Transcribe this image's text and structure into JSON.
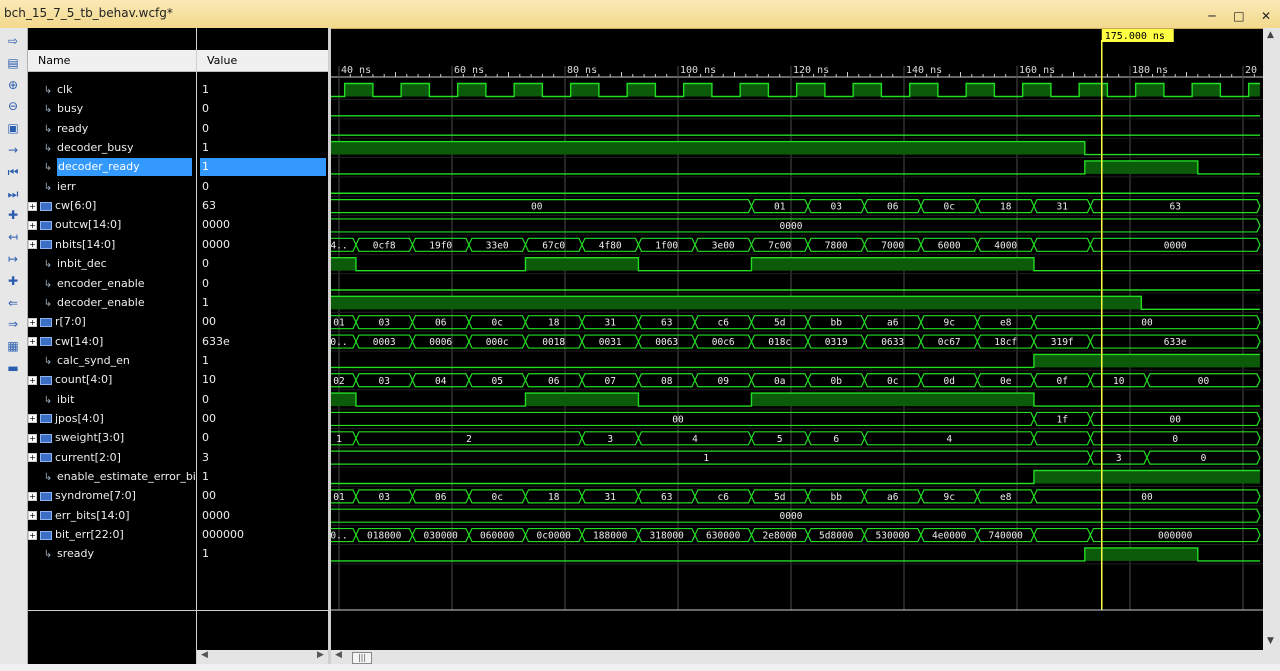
{
  "window": {
    "title": "bch_15_7_5_tb_behav.wcfg*"
  },
  "headers": {
    "name": "Name",
    "value": "Value"
  },
  "cursor": {
    "label": "175.000 ns",
    "time": 175
  },
  "timeline": {
    "ticks": [
      "40 ns",
      "60 ns",
      "80 ns",
      "100 ns",
      "120 ns",
      "140 ns",
      "160 ns",
      "180 ns",
      "20"
    ]
  },
  "signals": [
    {
      "name": "clk",
      "value": "1",
      "bus": false
    },
    {
      "name": "busy",
      "value": "0",
      "bus": false
    },
    {
      "name": "ready",
      "value": "0",
      "bus": false
    },
    {
      "name": "decoder_busy",
      "value": "1",
      "bus": false
    },
    {
      "name": "decoder_ready",
      "value": "1",
      "bus": false,
      "selected": true
    },
    {
      "name": "ierr",
      "value": "0",
      "bus": false
    },
    {
      "name": "cw[6:0]",
      "value": "63",
      "bus": true
    },
    {
      "name": "outcw[14:0]",
      "value": "0000",
      "bus": true
    },
    {
      "name": "nbits[14:0]",
      "value": "0000",
      "bus": true
    },
    {
      "name": "inbit_dec",
      "value": "0",
      "bus": false
    },
    {
      "name": "encoder_enable",
      "value": "0",
      "bus": false
    },
    {
      "name": "decoder_enable",
      "value": "1",
      "bus": false
    },
    {
      "name": "r[7:0]",
      "value": "00",
      "bus": true
    },
    {
      "name": "cw[14:0]",
      "value": "633e",
      "bus": true
    },
    {
      "name": "calc_synd_en",
      "value": "1",
      "bus": false
    },
    {
      "name": "count[4:0]",
      "value": "10",
      "bus": true
    },
    {
      "name": "ibit",
      "value": "0",
      "bus": false
    },
    {
      "name": "jpos[4:0]",
      "value": "00",
      "bus": true
    },
    {
      "name": "sweight[3:0]",
      "value": "0",
      "bus": true
    },
    {
      "name": "current[2:0]",
      "value": "3",
      "bus": true
    },
    {
      "name": "enable_estimate_error_bits",
      "value": "1",
      "bus": false
    },
    {
      "name": "syndrome[7:0]",
      "value": "00",
      "bus": true
    },
    {
      "name": "err_bits[14:0]",
      "value": "0000",
      "bus": true
    },
    {
      "name": "bit_err[22:0]",
      "value": "000000",
      "bus": true
    },
    {
      "name": "sready",
      "value": "1",
      "bus": false
    }
  ],
  "waves": [
    {
      "type": "clk"
    },
    {
      "type": "bit",
      "init": 0,
      "edges": []
    },
    {
      "type": "bit",
      "init": 0,
      "edges": []
    },
    {
      "type": "bit",
      "init": 1,
      "edges": [
        172
      ]
    },
    {
      "type": "bit",
      "init": 0,
      "edges": [
        172,
        192
      ]
    },
    {
      "type": "bit",
      "init": 0,
      "edges": []
    },
    {
      "type": "bus",
      "segs": [
        [
          37,
          113,
          "00"
        ],
        [
          113,
          123,
          "01"
        ],
        [
          123,
          133,
          "03"
        ],
        [
          133,
          143,
          "06"
        ],
        [
          143,
          153,
          "0c"
        ],
        [
          153,
          163,
          "18"
        ],
        [
          163,
          173,
          "31"
        ],
        [
          173,
          203,
          "63"
        ]
      ]
    },
    {
      "type": "bus",
      "segs": [
        [
          37,
          203,
          "0000"
        ]
      ]
    },
    {
      "type": "bus",
      "segs": [
        [
          37,
          43,
          "4.."
        ],
        [
          43,
          53,
          "0cf8"
        ],
        [
          53,
          63,
          "19f0"
        ],
        [
          63,
          73,
          "33e0"
        ],
        [
          73,
          83,
          "67c0"
        ],
        [
          83,
          93,
          "4f80"
        ],
        [
          93,
          103,
          "1f00"
        ],
        [
          103,
          113,
          "3e00"
        ],
        [
          113,
          123,
          "7c00"
        ],
        [
          123,
          133,
          "7800"
        ],
        [
          133,
          143,
          "7000"
        ],
        [
          143,
          153,
          "6000"
        ],
        [
          153,
          163,
          "4000"
        ],
        [
          163,
          173,
          ""
        ],
        [
          173,
          203,
          "0000"
        ]
      ]
    },
    {
      "type": "bit",
      "init": 1,
      "edges": [
        43,
        73,
        93,
        113,
        163
      ]
    },
    {
      "type": "bit",
      "init": 0,
      "edges": []
    },
    {
      "type": "bit",
      "init": 1,
      "edges": [
        182
      ]
    },
    {
      "type": "bus",
      "segs": [
        [
          37,
          43,
          "01"
        ],
        [
          43,
          53,
          "03"
        ],
        [
          53,
          63,
          "06"
        ],
        [
          63,
          73,
          "0c"
        ],
        [
          73,
          83,
          "18"
        ],
        [
          83,
          93,
          "31"
        ],
        [
          93,
          103,
          "63"
        ],
        [
          103,
          113,
          "c6"
        ],
        [
          113,
          123,
          "5d"
        ],
        [
          123,
          133,
          "bb"
        ],
        [
          133,
          143,
          "a6"
        ],
        [
          143,
          153,
          "9c"
        ],
        [
          153,
          163,
          "e8"
        ],
        [
          163,
          203,
          "00"
        ]
      ]
    },
    {
      "type": "bus",
      "segs": [
        [
          37,
          43,
          "0.."
        ],
        [
          43,
          53,
          "0003"
        ],
        [
          53,
          63,
          "0006"
        ],
        [
          63,
          73,
          "000c"
        ],
        [
          73,
          83,
          "0018"
        ],
        [
          83,
          93,
          "0031"
        ],
        [
          93,
          103,
          "0063"
        ],
        [
          103,
          113,
          "00c6"
        ],
        [
          113,
          123,
          "018c"
        ],
        [
          123,
          133,
          "0319"
        ],
        [
          133,
          143,
          "0633"
        ],
        [
          143,
          153,
          "0c67"
        ],
        [
          153,
          163,
          "18cf"
        ],
        [
          163,
          173,
          "319f"
        ],
        [
          173,
          203,
          "633e"
        ]
      ]
    },
    {
      "type": "bit",
      "init": 0,
      "edges": [
        163
      ]
    },
    {
      "type": "bus",
      "segs": [
        [
          37,
          43,
          "02"
        ],
        [
          43,
          53,
          "03"
        ],
        [
          53,
          63,
          "04"
        ],
        [
          63,
          73,
          "05"
        ],
        [
          73,
          83,
          "06"
        ],
        [
          83,
          93,
          "07"
        ],
        [
          93,
          103,
          "08"
        ],
        [
          103,
          113,
          "09"
        ],
        [
          113,
          123,
          "0a"
        ],
        [
          123,
          133,
          "0b"
        ],
        [
          133,
          143,
          "0c"
        ],
        [
          143,
          153,
          "0d"
        ],
        [
          153,
          163,
          "0e"
        ],
        [
          163,
          173,
          "0f"
        ],
        [
          173,
          183,
          "10"
        ],
        [
          183,
          203,
          "00"
        ]
      ]
    },
    {
      "type": "bit",
      "init": 1,
      "edges": [
        43,
        73,
        93,
        113,
        163
      ]
    },
    {
      "type": "bus",
      "segs": [
        [
          37,
          163,
          "00"
        ],
        [
          163,
          173,
          "1f"
        ],
        [
          173,
          203,
          "00"
        ]
      ]
    },
    {
      "type": "bus",
      "segs": [
        [
          37,
          43,
          "1"
        ],
        [
          43,
          83,
          "2"
        ],
        [
          83,
          93,
          "3"
        ],
        [
          93,
          113,
          "4"
        ],
        [
          113,
          123,
          "5"
        ],
        [
          123,
          133,
          "6"
        ],
        [
          133,
          163,
          "4"
        ],
        [
          163,
          173,
          ""
        ],
        [
          173,
          203,
          "0"
        ]
      ]
    },
    {
      "type": "bus",
      "segs": [
        [
          37,
          173,
          "1"
        ],
        [
          173,
          183,
          "3"
        ],
        [
          183,
          203,
          "0"
        ]
      ]
    },
    {
      "type": "bit",
      "init": 0,
      "edges": [
        163
      ]
    },
    {
      "type": "bus",
      "segs": [
        [
          37,
          43,
          "01"
        ],
        [
          43,
          53,
          "03"
        ],
        [
          53,
          63,
          "06"
        ],
        [
          63,
          73,
          "0c"
        ],
        [
          73,
          83,
          "18"
        ],
        [
          83,
          93,
          "31"
        ],
        [
          93,
          103,
          "63"
        ],
        [
          103,
          113,
          "c6"
        ],
        [
          113,
          123,
          "5d"
        ],
        [
          123,
          133,
          "bb"
        ],
        [
          133,
          143,
          "a6"
        ],
        [
          143,
          153,
          "9c"
        ],
        [
          153,
          163,
          "e8"
        ],
        [
          163,
          203,
          "00"
        ]
      ]
    },
    {
      "type": "bus",
      "segs": [
        [
          37,
          203,
          "0000"
        ]
      ]
    },
    {
      "type": "bus",
      "segs": [
        [
          37,
          43,
          "0.."
        ],
        [
          43,
          53,
          "018000"
        ],
        [
          53,
          63,
          "030000"
        ],
        [
          63,
          73,
          "060000"
        ],
        [
          73,
          83,
          "0c0000"
        ],
        [
          83,
          93,
          "188000"
        ],
        [
          93,
          103,
          "318000"
        ],
        [
          103,
          113,
          "630000"
        ],
        [
          113,
          123,
          "2e8000"
        ],
        [
          123,
          133,
          "5d8000"
        ],
        [
          133,
          143,
          "530000"
        ],
        [
          143,
          153,
          "4e0000"
        ],
        [
          153,
          163,
          "740000"
        ],
        [
          163,
          173,
          ""
        ],
        [
          173,
          203,
          "000000"
        ]
      ]
    },
    {
      "type": "bit",
      "init": 0,
      "edges": [
        172,
        192
      ]
    }
  ],
  "colors": {
    "wave": "#22dd22",
    "fill": "#0b5b0b",
    "cursor": "#ffff44",
    "selected": "#3399ff"
  },
  "toolbar": [
    "zoom-fit-icon",
    "save-icon",
    "zoom-in-icon",
    "zoom-out-icon",
    "zoom-full-icon",
    "go-cursor-icon",
    "go-start-icon",
    "go-end-icon",
    "add-marker-icon",
    "prev-transition-icon",
    "next-transition-icon",
    "add-icon",
    "swap-left-icon",
    "swap-right-icon",
    "snap-icon",
    "ruler-icon"
  ]
}
